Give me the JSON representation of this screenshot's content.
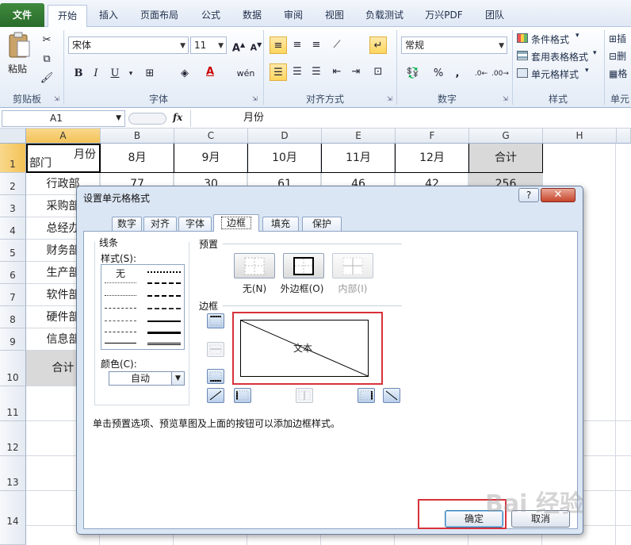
{
  "ribbon": {
    "tabs": [
      "文件",
      "开始",
      "插入",
      "页面布局",
      "公式",
      "数据",
      "审阅",
      "视图",
      "负载测试",
      "万兴PDF",
      "团队"
    ],
    "paste_label": "粘贴",
    "font_name": "宋体",
    "font_size": "11",
    "number_format": "常规",
    "percent": "%",
    "comma": ",",
    "bold": "B",
    "italic": "I",
    "underline": "U",
    "wen": "wén",
    "cond_format": "条件格式",
    "table_format": "套用表格格式",
    "cell_style": "单元格样式",
    "insert_partial": "插",
    "delete_partial": "删",
    "format_partial": "格",
    "groups": [
      "剪贴板",
      "字体",
      "对齐方式",
      "数字",
      "样式",
      "单元"
    ]
  },
  "formula_bar": {
    "cell_ref": "A1",
    "fx": "fx",
    "content": "月份"
  },
  "grid": {
    "columns": [
      "A",
      "B",
      "C",
      "D",
      "E",
      "F",
      "G",
      "H"
    ],
    "rows": [
      "1",
      "2",
      "3",
      "4",
      "5",
      "6",
      "7",
      "8",
      "9",
      "10",
      "11",
      "12",
      "13",
      "14"
    ],
    "a1_top": "月份",
    "a1_bottom": "部门",
    "headers": [
      "8月",
      "9月",
      "10月",
      "11月",
      "12月",
      "合计"
    ],
    "departments": [
      "行政部",
      "采购部",
      "总经办",
      "财务部",
      "生产部",
      "软件部",
      "硬件部",
      "信息部"
    ],
    "total_label": "合计",
    "row2_values": [
      "77",
      "30",
      "61",
      "46",
      "42",
      "256"
    ]
  },
  "dialog": {
    "title": "设置单元格格式",
    "help": "?",
    "close": "✕",
    "tabs": [
      "数字",
      "对齐",
      "字体",
      "边框",
      "填充",
      "保护"
    ],
    "active_tab": "边框",
    "line_section": "线条",
    "style_label": "样式(S):",
    "style_none": "无",
    "color_label": "颜色(C):",
    "color_value": "自动",
    "preset_section": "预置",
    "presets": [
      "无(N)",
      "外边框(O)",
      "内部(I)"
    ],
    "border_section": "边框",
    "preview_text": "文本",
    "hint": "单击预置选项、预览草图及上面的按钮可以添加边框样式。",
    "ok": "确定",
    "cancel": "取消"
  },
  "watermark": "Bai 经验",
  "colors": {
    "file_tab": "#2a6b2a",
    "highlight_red": "#d8323a",
    "selected_header": "#f3c257"
  }
}
